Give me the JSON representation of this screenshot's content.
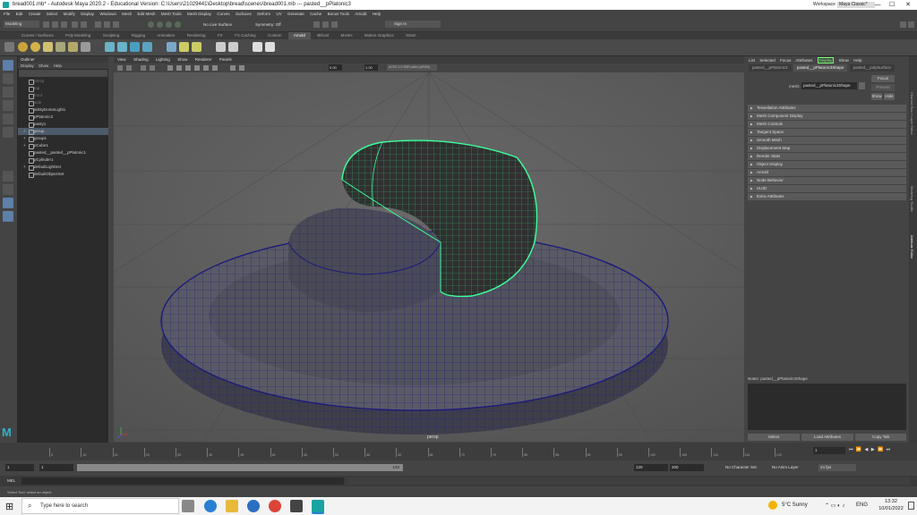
{
  "window": {
    "title": "bread001.mb* - Autodesk Maya 2020.2 - Educational Version: C:\\Users\\21029441\\Desktop\\bread\\scenes\\bread001.mb  ---  pasted__pPlatonic3",
    "workspace_label": "Workspace :",
    "workspace_value": "Maya Classic*",
    "minimize": "—",
    "maximize": "☐",
    "close": "✕"
  },
  "menubar": [
    "File",
    "Edit",
    "Create",
    "Select",
    "Modify",
    "Display",
    "Windows",
    "Mesh",
    "Edit Mesh",
    "Mesh Tools",
    "Mesh Display",
    "Curves",
    "Surfaces",
    "Deform",
    "UV",
    "Generate",
    "Cache",
    "Bonus Tools",
    "Arnold",
    "Help"
  ],
  "statusline": {
    "mode": "Modeling",
    "live_surface": "No Live Surface",
    "symmetry": "Symmetry: Off",
    "sign_in": "Sign In"
  },
  "shelf_tabs": [
    "Curves / Surfaces",
    "Poly Modeling",
    "Sculpting",
    "Rigging",
    "Animation",
    "Rendering",
    "FX",
    "FX Caching",
    "Custom",
    "Arnold",
    "Bifrost",
    "MASH",
    "Motion Graphics",
    "XGen"
  ],
  "shelf_active_tab": "Arnold",
  "outliner": {
    "title": "Outliner",
    "menu": [
      "Display",
      "Show",
      "Help"
    ],
    "items": [
      {
        "label": "persp",
        "dim": true,
        "sel": false,
        "exp": ""
      },
      {
        "label": "top",
        "dim": true,
        "sel": false,
        "exp": ""
      },
      {
        "label": "front",
        "dim": true,
        "sel": false,
        "exp": ""
      },
      {
        "label": "side",
        "dim": true,
        "sel": false,
        "exp": ""
      },
      {
        "label": "aiSkyDomeLight1",
        "dim": false,
        "sel": false,
        "exp": ""
      },
      {
        "label": "pPlatonic3",
        "dim": false,
        "sel": false,
        "exp": ""
      },
      {
        "label": "pasty1",
        "dim": false,
        "sel": false,
        "exp": ""
      },
      {
        "label": "group",
        "dim": false,
        "sel": true,
        "exp": "+"
      },
      {
        "label": "group1",
        "dim": false,
        "sel": false,
        "exp": "+"
      },
      {
        "label": "pCube1",
        "dim": false,
        "sel": false,
        "exp": "+"
      },
      {
        "label": "pasted__pasted__pPlatonic1",
        "dim": false,
        "sel": false,
        "exp": ""
      },
      {
        "label": "pCylinder1",
        "dim": false,
        "sel": false,
        "exp": ""
      },
      {
        "label": "defaultLightSet",
        "dim": false,
        "sel": false,
        "exp": "+"
      },
      {
        "label": "defaultObjectSet",
        "dim": false,
        "sel": false,
        "exp": ""
      }
    ]
  },
  "viewport": {
    "menu": [
      "View",
      "Shading",
      "Lighting",
      "Show",
      "Renderer",
      "Panels"
    ],
    "camera_label": "persp",
    "field1": "0.00",
    "field2": "1.00",
    "colorspace": "ACES 1.0 SDR-video (sRGB)"
  },
  "attribute_editor": {
    "menu": [
      "List",
      "Selected",
      "Focus",
      "Attributes",
      "Display",
      "Show",
      "Help"
    ],
    "tabs": [
      "pasted__pPlatonic3",
      "pasted__pPlatonic3Shape",
      "pasted__polySurface"
    ],
    "active_tab": 1,
    "mesh_label": "mesh:",
    "mesh_value": "pasted__pPlatonic3Shape",
    "focus_button": "Focus",
    "presets_button": "Presets",
    "show_button": "Show",
    "hide_button": "Hide",
    "sections": [
      "Tessellation Attributes",
      "Mesh Component Display",
      "Mesh Controls",
      "Tangent Space",
      "Smooth Mesh",
      "Displacement Map",
      "Render Stats",
      "Object Display",
      "Arnold",
      "Node Behavior",
      "UUID",
      "Extra Attributes"
    ],
    "notes_label": "Notes: pasted__pPlatonic3Shape",
    "select_button": "Select",
    "load_attributes_button": "Load Attributes",
    "copy_tab_button": "Copy Tab"
  },
  "right_tabs": [
    "Channel Box / Layer Editor",
    "Modeling Toolkit",
    "Attribute Editor"
  ],
  "timeslider": {
    "ticks": [
      "5",
      "10",
      "15",
      "20",
      "25",
      "30",
      "35",
      "40",
      "45",
      "50",
      "55",
      "60",
      "65",
      "70",
      "75",
      "80",
      "85",
      "90",
      "95",
      "100",
      "105",
      "110",
      "115",
      "120"
    ],
    "current_frame": "1"
  },
  "rangeslider": {
    "start": "1",
    "inner_start": "1",
    "inner_end": "120",
    "end_inner": "120",
    "end": "200",
    "character_set": "No Character Set",
    "anim_layer": "No Anim Layer",
    "fps": "24 fps"
  },
  "mel": {
    "label": "MEL"
  },
  "helpline": "Select Tool: select an object",
  "taskbar": {
    "search_placeholder": "Type here to search",
    "weather": "5°C  Sunny",
    "language": "ENG",
    "time": "13:32",
    "date": "10/01/2022"
  },
  "colors": {
    "mesh_wire": "#1c1c7a",
    "selected_wire": "#3cff9a",
    "viewport_bg": "#595959"
  }
}
